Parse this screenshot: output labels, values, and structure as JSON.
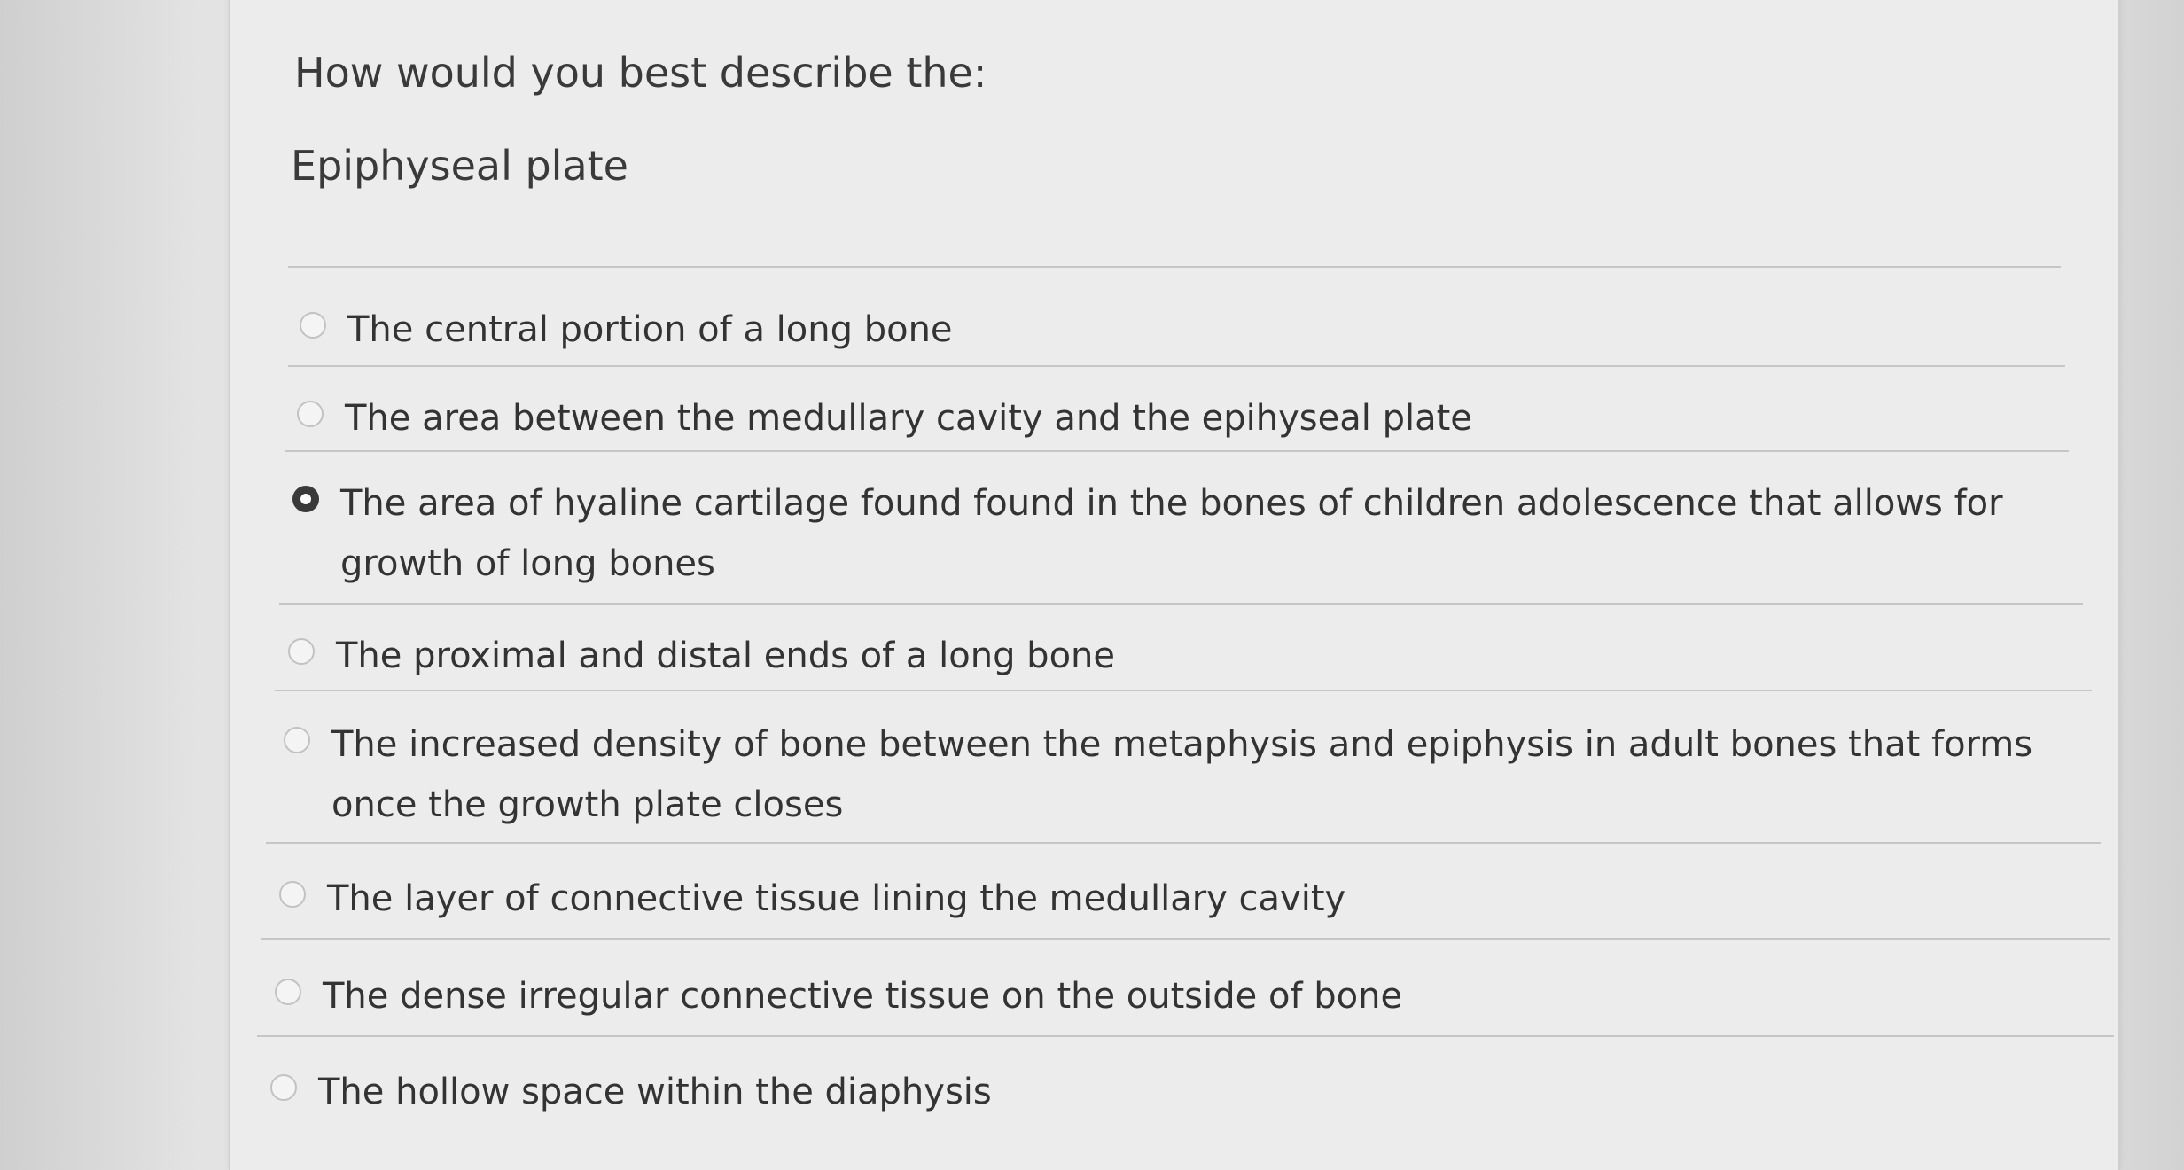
{
  "question": {
    "prompt": "How would you best describe the:",
    "term": "Epiphyseal plate"
  },
  "options": [
    {
      "label": "The central portion of a long bone",
      "selected": false
    },
    {
      "label": "The area between the medullary cavity and the epihyseal plate",
      "selected": false
    },
    {
      "label": "The area of hyaline cartilage found found in the bones of children adolescence that allows for growth of long bones",
      "selected": true
    },
    {
      "label": "The proximal and distal ends of a long bone",
      "selected": false
    },
    {
      "label": "The increased density of bone between the metaphysis and epiphysis in adult bones that forms once the growth plate closes",
      "selected": false
    },
    {
      "label": "The layer of connective tissue lining the medullary cavity",
      "selected": false
    },
    {
      "label": "The dense irregular connective tissue on the outside of bone",
      "selected": false
    },
    {
      "label": "The hollow space within the diaphysis",
      "selected": false
    }
  ]
}
